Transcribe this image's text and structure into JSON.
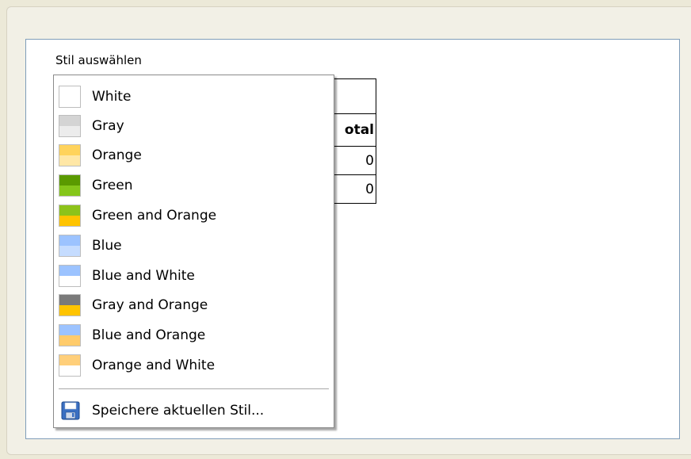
{
  "panel": {
    "label": "Stil auswählen"
  },
  "table": {
    "header_total": "otal",
    "row1_value": "0",
    "row2_value": "0"
  },
  "menu": {
    "items": [
      {
        "label": "White",
        "colors": [
          "#ffffff",
          "#ffffff"
        ]
      },
      {
        "label": "Gray",
        "colors": [
          "#d4d4d4",
          "#ececec"
        ]
      },
      {
        "label": "Orange",
        "colors": [
          "#ffd35c",
          "#ffe7a6"
        ]
      },
      {
        "label": "Green",
        "colors": [
          "#5a9a00",
          "#85c61a"
        ]
      },
      {
        "label": "Green and Orange",
        "colors": [
          "#8dc31a",
          "#ffc400"
        ]
      },
      {
        "label": "Blue",
        "colors": [
          "#9cc3ff",
          "#c5dcff"
        ]
      },
      {
        "label": "Blue and White",
        "colors": [
          "#9cc3ff",
          "#ffffff"
        ]
      },
      {
        "label": "Gray and Orange",
        "colors": [
          "#7a7a7a",
          "#ffc400"
        ]
      },
      {
        "label": "Blue and Orange",
        "colors": [
          "#9cc3ff",
          "#ffcb6b"
        ]
      },
      {
        "label": "Orange and White",
        "colors": [
          "#ffcf7a",
          "#ffffff"
        ]
      }
    ],
    "save_label": "Speichere aktuellen Stil...",
    "save_icon": "floppy-disk-icon"
  }
}
